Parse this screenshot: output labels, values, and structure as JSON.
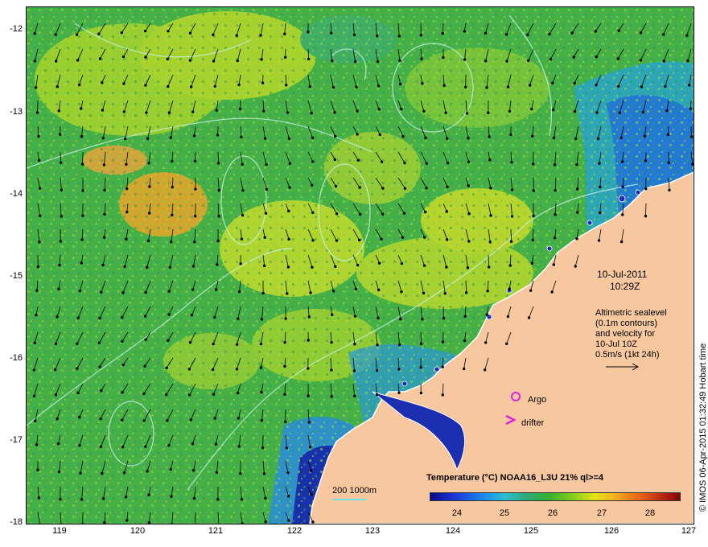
{
  "map": {
    "y_axis_ticks": [
      "-12",
      "-13",
      "-14",
      "-15",
      "-16",
      "-17",
      "-18"
    ],
    "x_axis_ticks": [
      "119",
      "120",
      "121",
      "122",
      "123",
      "124",
      "125",
      "126",
      "127"
    ],
    "lat_range": [
      -18,
      -11.8
    ],
    "lon_range": [
      118.6,
      127
    ],
    "land_color": "#f7c7a0",
    "ocean_base_color": "#4bb54b",
    "contour_color": "#c8f0f0",
    "vector_color": "#000000"
  },
  "annotations": {
    "date": "10-Jul-2011",
    "time": "10:29Z",
    "info_lines": [
      "Altimetric sealevel",
      "(0.1m contours)",
      "and velocity for",
      "10-Jul 10Z",
      "0.5m/s (1kt 24h)"
    ],
    "credit": "© IMOS 06-Apr-2015 01:32:49 Hobart time"
  },
  "markers": {
    "argo_label": "Argo",
    "drifter_label": "drifter",
    "marker_color": "#e020e0"
  },
  "scale": {
    "label": "200  1000m"
  },
  "legend": {
    "title": "Temperature (°C) NOAA16_L3U 21% ql>=4",
    "ticks": [
      "24",
      "25",
      "26",
      "27",
      "28"
    ]
  }
}
